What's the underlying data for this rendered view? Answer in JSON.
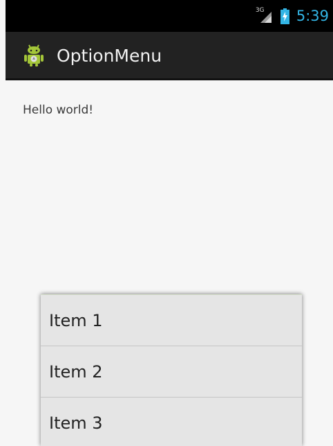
{
  "status_bar": {
    "network": "3G",
    "time": "5:39"
  },
  "action_bar": {
    "title": "OptionMenu"
  },
  "content": {
    "text": "Hello world!"
  },
  "menu": {
    "items": [
      {
        "label": "Item 1"
      },
      {
        "label": "Item 2"
      },
      {
        "label": "Item 3"
      }
    ]
  },
  "colors": {
    "status_bar_bg": "#000000",
    "action_bar_bg": "#222222",
    "time_color": "#33b5e5",
    "content_bg": "#f6f6f6",
    "menu_bg": "#e5e5e5"
  }
}
